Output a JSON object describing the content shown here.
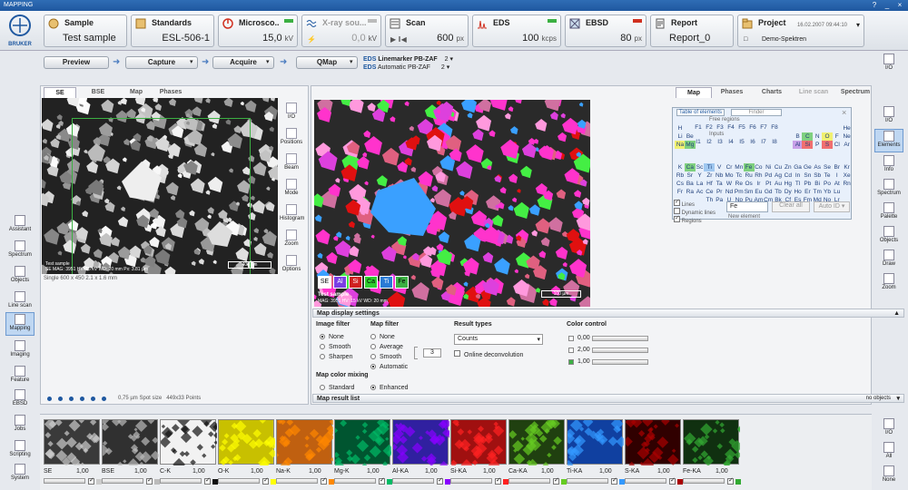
{
  "window": {
    "title": "MAPPING",
    "help": "?",
    "minimize": "_",
    "close": "×"
  },
  "brand": {
    "logo_text": "BRUKER"
  },
  "cards": {
    "sample": {
      "title": "Sample",
      "value": "Test sample"
    },
    "standards": {
      "title": "Standards",
      "value": "ESL-506-1"
    },
    "microscope": {
      "title": "Microsco...",
      "value": "15,0",
      "unit": "kV"
    },
    "xray": {
      "title": "X-ray sou...",
      "value": "0,0",
      "unit": "kV"
    },
    "scan": {
      "title": "Scan",
      "value": "600",
      "unit": "px"
    },
    "eds": {
      "title": "EDS",
      "value": "100",
      "unit": "kcps"
    },
    "ebsd": {
      "title": "EBSD",
      "value": "80",
      "unit": "px"
    },
    "report": {
      "title": "Report",
      "value": "Report_0"
    },
    "project": {
      "title": "Project",
      "date": "16.02.2007 09:44:10",
      "value": "Demo-Spektren"
    }
  },
  "workflow": {
    "preview": "Preview",
    "capture": "Capture",
    "acquire": "Acquire",
    "qmap": "QMap",
    "eds_tag1": "EDS",
    "eds_line1": "Linemarker PB-ZAF",
    "eds_n1": "2",
    "eds_tag2": "EDS",
    "eds_line2": "Automatic PB-ZAF",
    "eds_n2": "2"
  },
  "left_sidebar": [
    "Assistant",
    "Spectrum",
    "Objects",
    "Line scan",
    "Mapping",
    "Imaging",
    "Feature",
    "EBSD",
    "Jobs",
    "Scripting",
    "System"
  ],
  "right_sidebar": [
    "I/O",
    "I/O",
    "Elements",
    "Info",
    "Spectrum",
    "Palette",
    "Objects",
    "Draw",
    "Zoom"
  ],
  "image_tabs": [
    "SE",
    "BSE",
    "Map",
    "Phases"
  ],
  "image_tools": [
    "I/O",
    "Positions",
    "Beam",
    "Mode",
    "Histogram",
    "Zoom",
    "Options"
  ],
  "se_image": {
    "label": "Test sample",
    "meta": "SE MAG: 3951   HV: 15 kV   WD: 20 mm   Px: 3.81 µm",
    "scale": "400 µm",
    "info": "Single     600 x 450    2.1 x 1.6 mm"
  },
  "spot": {
    "size": "0,75 µm",
    "label_size": "Spot size",
    "points_count": "449x33",
    "label_points": "Points"
  },
  "map_image": {
    "label": "Test sample",
    "meta": "MAG: 3951   HV: 15 kV   WD: 20 mm",
    "scale": "100 µm",
    "chips": [
      "SE",
      "Al",
      "Si",
      "Ca",
      "Ti",
      "Fe"
    ]
  },
  "right_tabs": [
    "Map",
    "Phases",
    "Charts",
    "Line scan",
    "Spectrum"
  ],
  "periodic": {
    "tab1": "Table of elements",
    "tab2": "Finder",
    "free": "Free regions",
    "inputs": "Inputs",
    "rows": [
      [
        "H",
        "",
        "",
        "",
        "",
        "",
        "",
        "",
        "",
        "",
        "",
        "",
        "",
        "",
        "",
        "",
        "",
        "He"
      ],
      [
        "Li",
        "Be",
        "",
        "",
        "",
        "",
        "",
        "",
        "",
        "",
        "",
        "",
        "B",
        "C",
        "N",
        "O",
        "F",
        "Ne"
      ],
      [
        "Na",
        "Mg",
        "",
        "",
        "",
        "",
        "",
        "",
        "",
        "",
        "",
        "",
        "Al",
        "Si",
        "P",
        "S",
        "Cl",
        "Ar"
      ],
      [
        "K",
        "Ca",
        "Sc",
        "Ti",
        "V",
        "Cr",
        "Mn",
        "Fe",
        "Co",
        "Ni",
        "Cu",
        "Zn",
        "Ga",
        "Ge",
        "As",
        "Se",
        "Br",
        "Kr"
      ],
      [
        "Rb",
        "Sr",
        "Y",
        "Zr",
        "Nb",
        "Mo",
        "Tc",
        "Ru",
        "Rh",
        "Pd",
        "Ag",
        "Cd",
        "In",
        "Sn",
        "Sb",
        "Te",
        "I",
        "Xe"
      ],
      [
        "Cs",
        "Ba",
        "La",
        "Hf",
        "Ta",
        "W",
        "Re",
        "Os",
        "Ir",
        "Pt",
        "Au",
        "Hg",
        "Tl",
        "Pb",
        "Bi",
        "Po",
        "At",
        "Rn"
      ],
      [
        "Fr",
        "Ra",
        "Ac",
        "Ce",
        "Pr",
        "Nd",
        "Pm",
        "Sm",
        "Eu",
        "Gd",
        "Tb",
        "Dy",
        "Ho",
        "Er",
        "Tm",
        "Yb",
        "Lu",
        ""
      ],
      [
        "",
        "",
        "",
        "Th",
        "Pa",
        "U",
        "Np",
        "Pu",
        "Am",
        "Cm",
        "Bk",
        "Cf",
        "Es",
        "Fm",
        "Md",
        "No",
        "Lr",
        ""
      ]
    ],
    "flabels": [
      "F1",
      "F2",
      "F3",
      "F4",
      "F5",
      "F6",
      "F7",
      "F8"
    ],
    "ilabels": [
      "I1",
      "I2",
      "I3",
      "I4",
      "I5",
      "I6",
      "I7",
      "I8"
    ],
    "cb_lines": "Lines",
    "cb_dyn": "Dynamic lines",
    "cb_regions": "Regions",
    "input": "Fe",
    "clear_all": "Clear all",
    "auto_id": "Auto ID",
    "new_element": "New element"
  },
  "settings": {
    "title": "Map display settings",
    "image_filter": {
      "label": "Image filter",
      "opts": [
        "None",
        "Smooth",
        "Sharpen"
      ]
    },
    "map_filter": {
      "label": "Map filter",
      "opts": [
        "None",
        "Average",
        "Smooth",
        "Automatic"
      ],
      "num": "3"
    },
    "color_mixing": {
      "label": "Map color mixing",
      "opts": [
        "Standard",
        "Enhanced"
      ]
    },
    "result_types": {
      "label": "Result types",
      "value": "Counts",
      "deconv": "Online deconvolution"
    },
    "color_control": {
      "label": "Color control",
      "v1": "0,00",
      "v2": "2,00",
      "v3": "1,00"
    },
    "result_list": "Map result list",
    "no_objects": "no objects"
  },
  "thumbs": [
    {
      "label": "SE",
      "val": "1,00"
    },
    {
      "label": "BSE",
      "val": "1,00"
    },
    {
      "label": "C-K",
      "val": "1,00"
    },
    {
      "label": "O-K",
      "val": "1,00"
    },
    {
      "label": "Na-K",
      "val": "1,00"
    },
    {
      "label": "Mg-K",
      "val": "1,00"
    },
    {
      "label": "Al-KA",
      "val": "1,00"
    },
    {
      "label": "Si-KA",
      "val": "1,00"
    },
    {
      "label": "Ca-KA",
      "val": "1,00"
    },
    {
      "label": "Ti-KA",
      "val": "1,00"
    },
    {
      "label": "S-KA",
      "val": "1,00"
    },
    {
      "label": "Fe-KA",
      "val": "1,00"
    }
  ],
  "bottom_right": [
    "I/O",
    "All",
    "None"
  ],
  "colors": {
    "accent": "#1f58a0",
    "green": "#3cb043",
    "red": "#d03020"
  }
}
